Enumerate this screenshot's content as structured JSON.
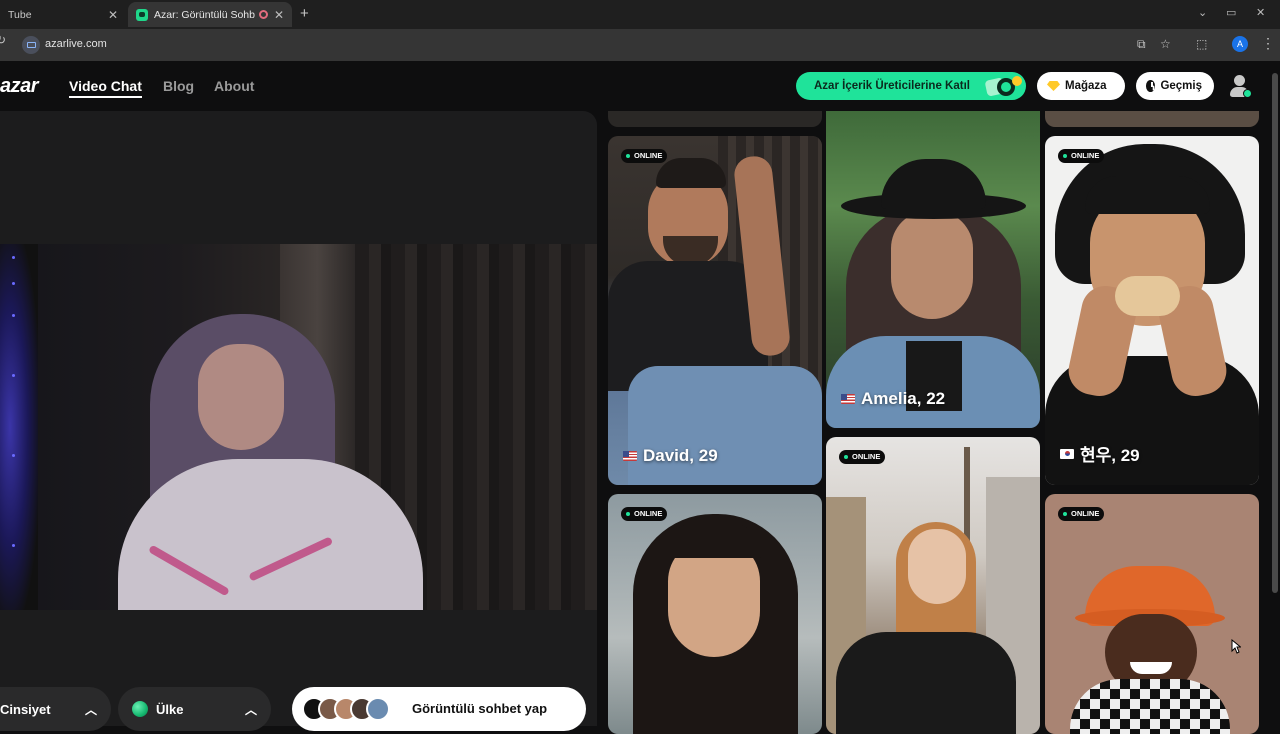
{
  "browser": {
    "tabs": [
      {
        "title": "Tube"
      },
      {
        "title": "Azar: Görüntülü Sohbet & V"
      }
    ],
    "url": "azarlive.com",
    "profile_initial": "A"
  },
  "site": {
    "logo": "azar",
    "nav": [
      "Video Chat",
      "Blog",
      "About"
    ],
    "cta_label": "Azar İçerik Üreticilerine Katıl",
    "shop_label": "Mağaza",
    "history_label": "Geçmiş"
  },
  "controls": {
    "gender_label": "Cinsiyet",
    "country_label": "Ülke",
    "start_label": "Görüntülü sohbet yap"
  },
  "profiles": [
    {
      "status": "ONLINE",
      "name": "David, 29",
      "flag": "us"
    },
    {
      "status": "",
      "name": "Amelia, 22",
      "flag": "us"
    },
    {
      "status": "ONLINE",
      "name": "현우, 29",
      "flag": "kr"
    },
    {
      "status": "ONLINE",
      "name": "",
      "flag": ""
    },
    {
      "status": "ONLINE",
      "name": "",
      "flag": ""
    },
    {
      "status": "ONLINE",
      "name": "",
      "flag": ""
    }
  ],
  "colors": {
    "accent": "#1fe39a",
    "background": "#0e0e0f",
    "panel": "#1c1c1d"
  }
}
